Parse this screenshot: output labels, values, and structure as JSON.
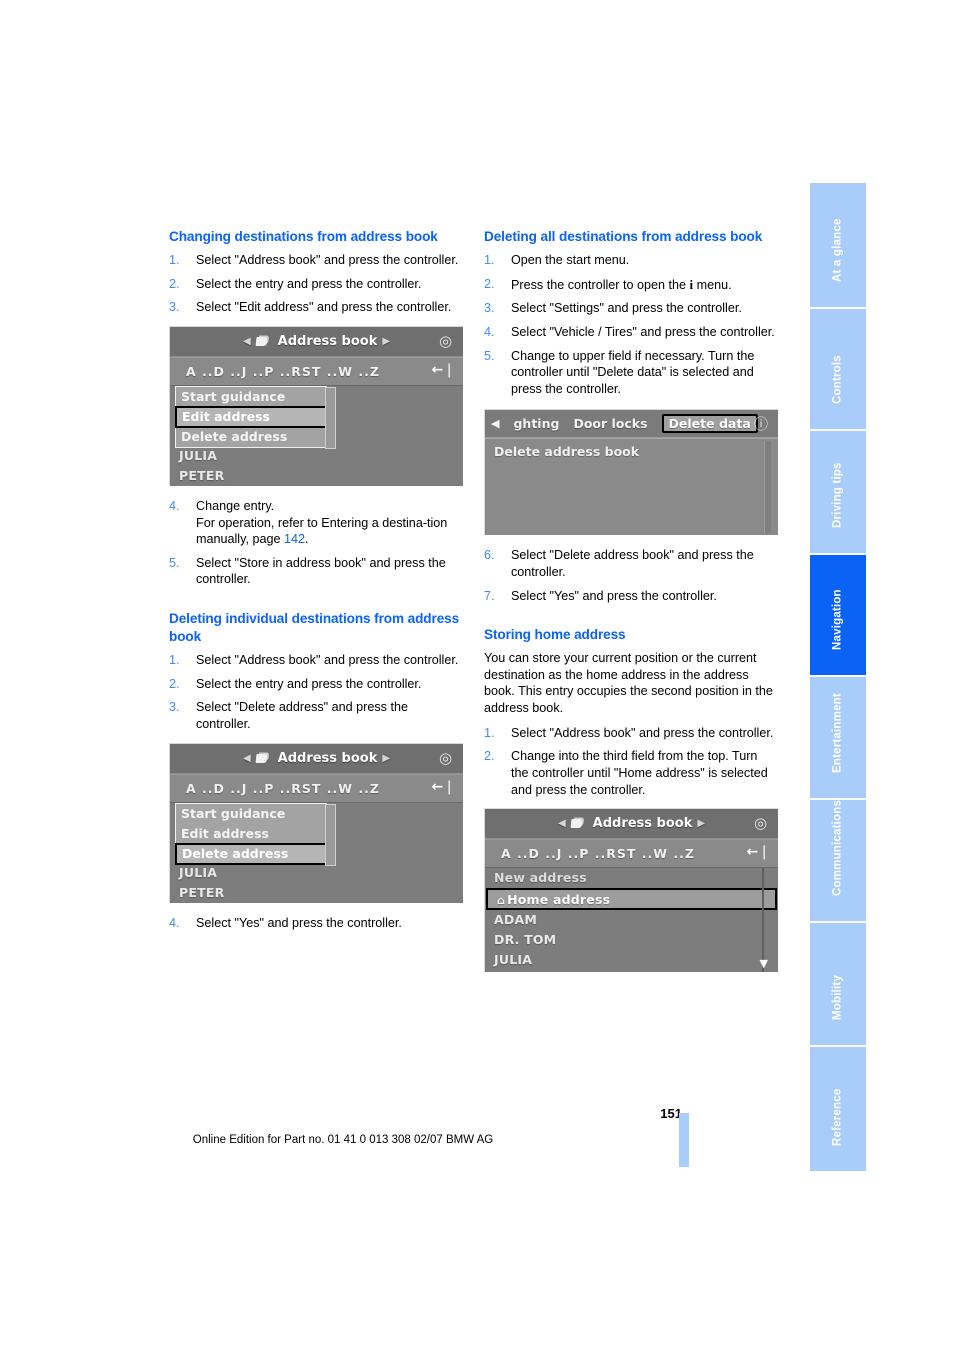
{
  "document": {
    "page_number": "151",
    "footer_note": "Online Edition for Part no. 01 41 0 013 308 02/07 BMW AG"
  },
  "side_tabs": [
    {
      "label": "At a glance",
      "active": false
    },
    {
      "label": "Controls",
      "active": false
    },
    {
      "label": "Driving tips",
      "active": false
    },
    {
      "label": "Navigation",
      "active": true
    },
    {
      "label": "Entertainment",
      "active": false
    },
    {
      "label": "Communications",
      "active": false
    },
    {
      "label": "Mobility",
      "active": false
    },
    {
      "label": "Reference",
      "active": false
    }
  ],
  "left_column": {
    "section1": {
      "heading": "Changing destinations from address book",
      "steps": [
        {
          "num": "1.",
          "text": "Select \"Address book\" and press the controller."
        },
        {
          "num": "2.",
          "text": "Select the entry and press the controller."
        },
        {
          "num": "3.",
          "text": "Select \"Edit address\" and press the controller."
        }
      ]
    },
    "screenshot1": {
      "title": "Address book",
      "letters": "A ..D ..J ..P ..RST ..W ..Z",
      "back_icon": "←❘",
      "menu_items": [
        {
          "label": "Start guidance",
          "selected": false
        },
        {
          "label": "Edit address",
          "selected": true
        },
        {
          "label": "Delete address",
          "selected": false
        }
      ],
      "entries": [
        "JULIA",
        "PETER"
      ]
    },
    "section1_steps_cont": [
      {
        "num": "4.",
        "text": "Change entry.",
        "text2a": "For operation, refer to Entering a destina-tion manually, page ",
        "pageref": "142",
        "text2b": "."
      },
      {
        "num": "5.",
        "text": "Select \"Store in address book\" and press the controller."
      }
    ],
    "section2": {
      "heading": "Deleting individual destinations from address book",
      "steps": [
        {
          "num": "1.",
          "text": "Select \"Address book\" and press the controller."
        },
        {
          "num": "2.",
          "text": "Select the entry and press the controller."
        },
        {
          "num": "3.",
          "text": "Select \"Delete address\" and press the controller."
        }
      ]
    },
    "screenshot2": {
      "title": "Address book",
      "letters": "A ..D ..J ..P ..RST ..W ..Z",
      "back_icon": "←❘",
      "menu_items": [
        {
          "label": "Start guidance",
          "selected": false
        },
        {
          "label": "Edit address",
          "selected": false
        },
        {
          "label": "Delete address",
          "selected": true
        }
      ],
      "entries": [
        "JULIA",
        "PETER"
      ]
    },
    "section2_steps_cont": [
      {
        "num": "4.",
        "text": "Select \"Yes\" and press the controller."
      }
    ]
  },
  "right_column": {
    "section1": {
      "heading": "Deleting all destinations from address book",
      "steps": [
        {
          "num": "1.",
          "text": "Open the start menu."
        },
        {
          "num": "2.",
          "text_before": "Press the controller to open the ",
          "symbol": "i",
          "text_after": " menu."
        },
        {
          "num": "3.",
          "text": "Select \"Settings\" and press the controller."
        },
        {
          "num": "4.",
          "text": "Select \"Vehicle / Tires\" and press the controller."
        },
        {
          "num": "5.",
          "text": "Change to upper field if necessary. Turn the controller until \"Delete data\" is selected and press the controller."
        }
      ]
    },
    "screenshot1": {
      "tabs": [
        {
          "label": "ghting",
          "selected": false
        },
        {
          "label": "Door locks",
          "selected": false
        },
        {
          "label": "Delete data",
          "selected": true
        }
      ],
      "item": "Delete address book"
    },
    "section1_steps_cont": [
      {
        "num": "6.",
        "text": "Select \"Delete address book\" and press the controller."
      },
      {
        "num": "7.",
        "text": "Select \"Yes\" and press the controller."
      }
    ],
    "section2": {
      "heading": "Storing home address",
      "body": "You can store your current position or the current destination as the home address in the address book. This entry occupies the second position in the address book.",
      "steps": [
        {
          "num": "1.",
          "text": "Select \"Address book\" and press the controller."
        },
        {
          "num": "2.",
          "text": "Change into the third field from the top. Turn the controller until \"Home address\" is selected and press the controller."
        }
      ]
    },
    "screenshot2": {
      "title": "Address book",
      "letters": "A ..D ..J ..P ..RST ..W ..Z",
      "back_icon": "←❘",
      "rows": [
        {
          "label": "New address",
          "selected": false,
          "home": false
        },
        {
          "label": "Home address",
          "selected": true,
          "home": true
        },
        {
          "label": "ADAM",
          "selected": false,
          "home": false
        },
        {
          "label": "DR. TOM",
          "selected": false,
          "home": false
        },
        {
          "label": "JULIA",
          "selected": false,
          "home": false
        }
      ]
    }
  },
  "colors": {
    "accent_blue": "#0b63f6",
    "tab_blue": "#a8cdfb",
    "number_blue": "#3e8bf7"
  }
}
